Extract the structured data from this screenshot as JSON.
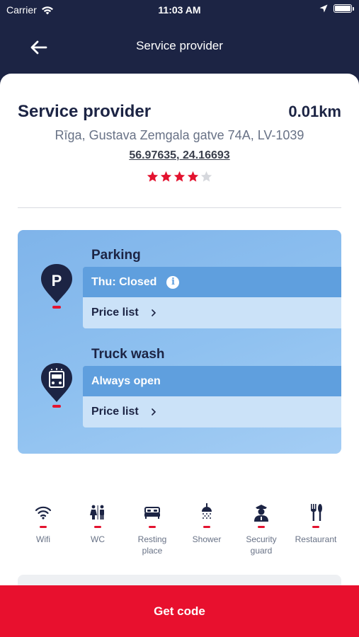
{
  "status_bar": {
    "carrier": "Carrier",
    "time": "11:03 AM"
  },
  "nav": {
    "title": "Service provider"
  },
  "provider": {
    "name": "Service provider",
    "distance": "0.01km",
    "address": "Rīga, Gustava Zemgala gatve 74A, LV-1039",
    "coordinates": "56.97635, 24.16693",
    "rating": 4,
    "rating_max": 5
  },
  "services": [
    {
      "name": "Parking",
      "status": "Thu: Closed",
      "price_label": "Price list",
      "icon": "parking-pin-icon"
    },
    {
      "name": "Truck wash",
      "status": "Always open",
      "price_label": "Price list",
      "icon": "truck-wash-pin-icon"
    }
  ],
  "amenities": [
    {
      "label": "Wifi",
      "icon": "wifi-icon"
    },
    {
      "label": "WC",
      "icon": "wc-icon"
    },
    {
      "label": "Resting place",
      "icon": "bed-icon"
    },
    {
      "label": "Shower",
      "icon": "shower-icon"
    },
    {
      "label": "Security guard",
      "icon": "security-guard-icon"
    },
    {
      "label": "Restaurant",
      "icon": "restaurant-icon"
    }
  ],
  "cta": {
    "label": "Get code"
  },
  "colors": {
    "navy": "#1c2444",
    "accent_red": "#e8102e",
    "panel_blue": "#8fc1f0",
    "star_red": "#e3132f",
    "star_empty": "#d6d8dd"
  }
}
